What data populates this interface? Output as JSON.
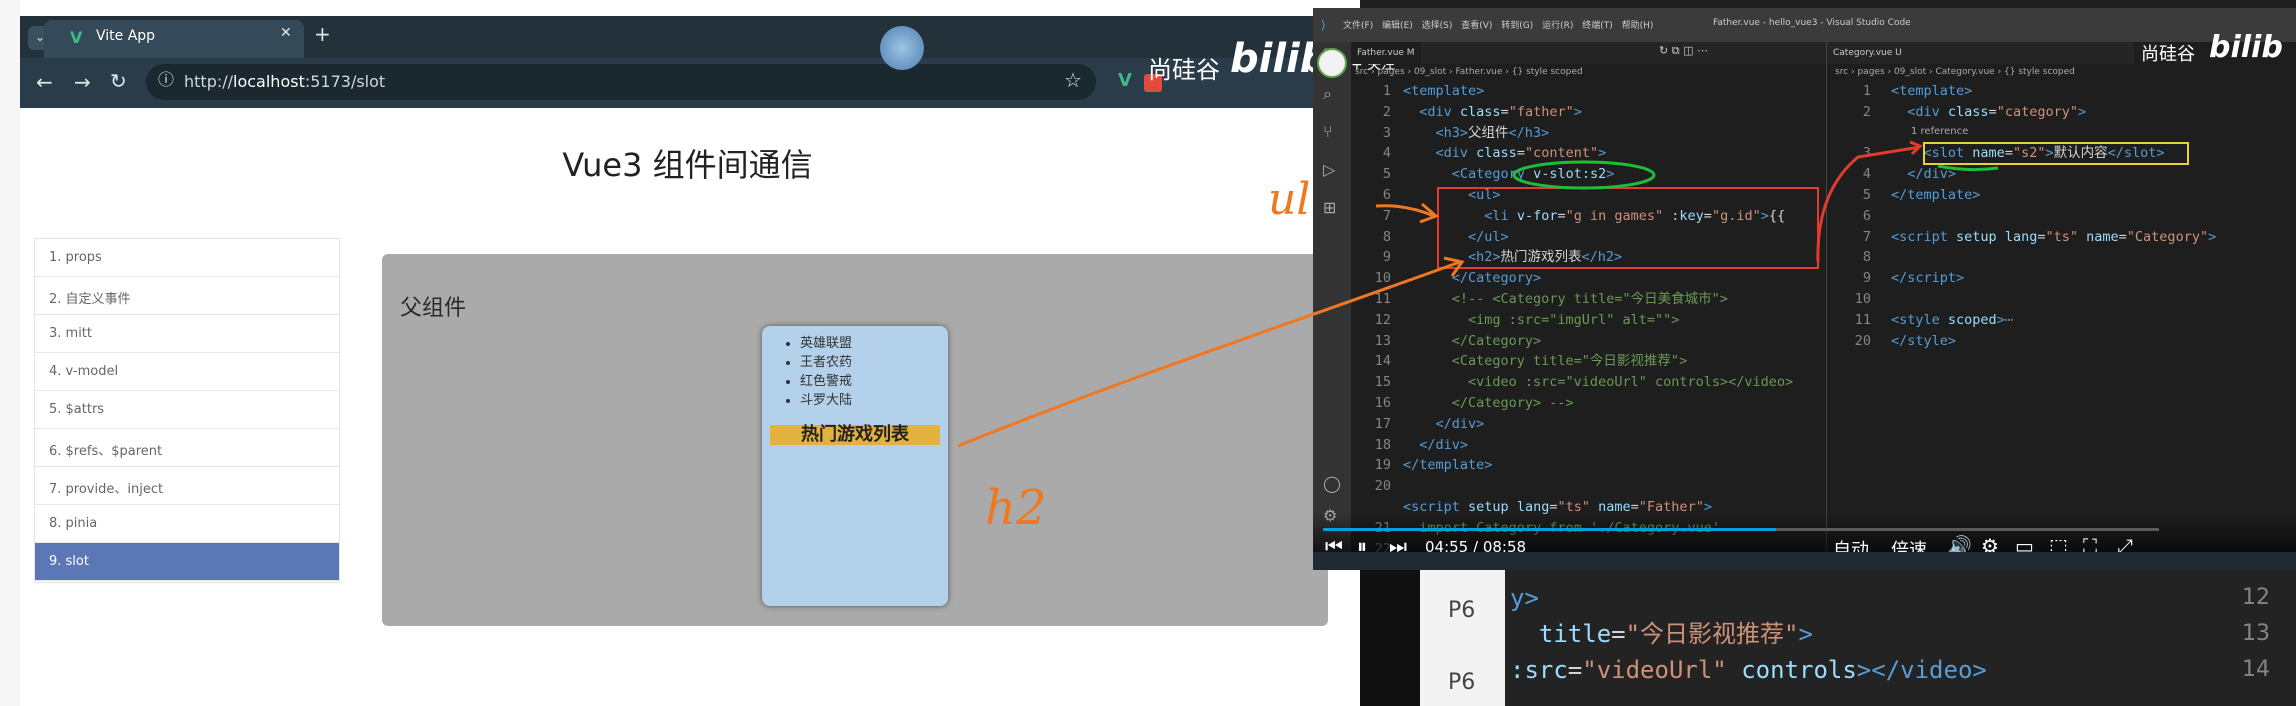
{
  "browser": {
    "tab_title": "Vite App",
    "url_host": "http://",
    "url_bold": "localhost",
    "url_rest": ":5173/slot",
    "watermark": "尚硅谷"
  },
  "app": {
    "page_title": "Vue3 组件间通信",
    "nav": [
      "1. props",
      "2. 自定义事件",
      "3. mitt",
      "4. v-model",
      "5. $attrs",
      "6. $refs、$parent",
      "7. provide、inject",
      "8. pinia",
      "9. slot"
    ],
    "active_index": 8,
    "father_title": "父组件",
    "games": [
      "英雄联盟",
      "王者农药",
      "红色警戒",
      "斗罗大陆"
    ],
    "games_title": "热门游戏列表"
  },
  "vscode": {
    "menu": "文件(F) 编辑(E) 选择(S) 查看(V) 转到(G) 运行(R) 终端(T) 帮助(H)",
    "window_title": "Father.vue - hello_vue3 - Visual Studio Code",
    "follow": "+ 关注",
    "left_tab": "Father.vue M",
    "left_crumb": "src › pages › 09_slot › Father.vue › {} style scoped",
    "right_tab": "Category.vue U",
    "right_crumb": "src › pages › 09_slot › Category.vue › {} style scoped",
    "references": "1 reference",
    "player": {
      "time": "04:55 / 08:58",
      "auto": "自动",
      "speed": "倍速"
    }
  },
  "annotations": {
    "ul_mark": "ul",
    "h2_mark": "h2"
  },
  "background": {
    "labels": [
      "P6",
      "P6"
    ],
    "numbers": [
      "12",
      "13",
      "14"
    ]
  },
  "colors": {
    "accent": "#5c77b5",
    "highlight_red": "#e33b2e",
    "highlight_green": "#1dbf3a",
    "annotation_orange": "#f07822"
  }
}
